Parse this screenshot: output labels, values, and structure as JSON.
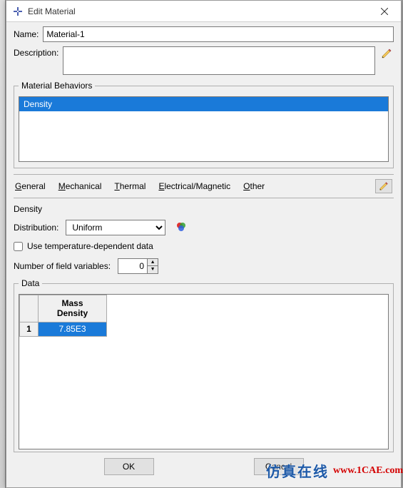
{
  "window": {
    "title": "Edit Material"
  },
  "form": {
    "name_label": "Name:",
    "name_value": "Material-1",
    "desc_label": "Description:",
    "desc_value": ""
  },
  "behaviors": {
    "legend": "Material Behaviors",
    "items": [
      "Density"
    ],
    "selected_index": 0
  },
  "menu": {
    "general": "General",
    "mechanical": "Mechanical",
    "thermal": "Thermal",
    "electrical": "Electrical/Magnetic",
    "other": "Other"
  },
  "density": {
    "section": "Density",
    "dist_label": "Distribution:",
    "dist_value": "Uniform",
    "temp_dep_label": "Use temperature-dependent data",
    "temp_dep_checked": false,
    "fieldvars_label": "Number of field variables:",
    "fieldvars_value": "0",
    "data_legend": "Data",
    "col_header": "Mass\nDensity",
    "row_index": "1",
    "cell_value": "7.85E3"
  },
  "buttons": {
    "ok": "OK",
    "cancel": "Cancel"
  },
  "watermark": {
    "cn": "仿真在线",
    "url": "www.1CAE.com"
  }
}
